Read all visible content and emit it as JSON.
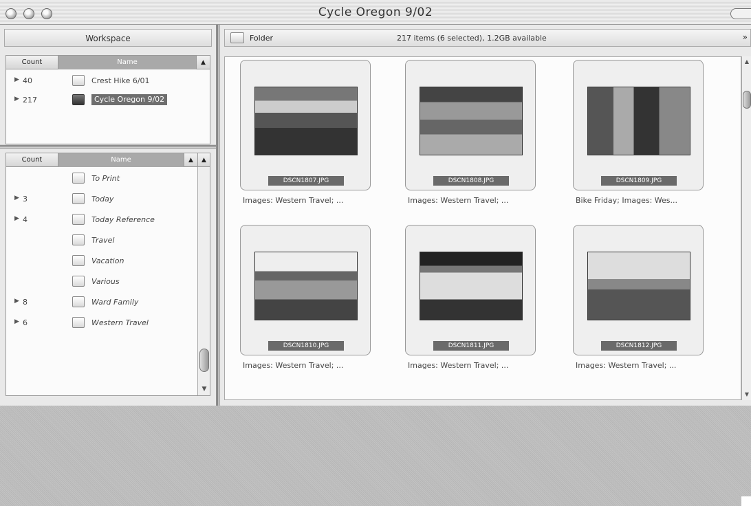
{
  "window": {
    "title": "Cycle Oregon 9/02"
  },
  "workspace": {
    "header": "Workspace",
    "top_panel": {
      "columns": {
        "count": "Count",
        "name": "Name"
      },
      "rows": [
        {
          "count": "40",
          "name": "Crest Hike 6/01",
          "selected": false
        },
        {
          "count": "217",
          "name": "Cycle Oregon 9/02",
          "selected": true
        }
      ]
    },
    "bottom_panel": {
      "columns": {
        "count": "Count",
        "name": "Name"
      },
      "rows": [
        {
          "count": "",
          "name": "To Print",
          "italic": true,
          "expandable": false
        },
        {
          "count": "3",
          "name": "Today",
          "italic": true,
          "expandable": true
        },
        {
          "count": "4",
          "name": "Today Reference",
          "italic": true,
          "expandable": true
        },
        {
          "count": "",
          "name": "Travel",
          "italic": true,
          "expandable": false
        },
        {
          "count": "",
          "name": "Vacation",
          "italic": true,
          "expandable": false
        },
        {
          "count": "",
          "name": "Various",
          "italic": true,
          "expandable": false
        },
        {
          "count": "8",
          "name": "Ward Family",
          "italic": true,
          "expandable": true
        },
        {
          "count": "6",
          "name": "Western Travel",
          "italic": true,
          "expandable": true
        }
      ]
    }
  },
  "browser": {
    "folder_label": "Folder",
    "status": "217 items (6 selected), 1.2GB available",
    "items": [
      {
        "filename": "DSCN1807.JPG",
        "caption": "Images: Western Travel; ..."
      },
      {
        "filename": "DSCN1808.JPG",
        "caption": "Images: Western Travel; ..."
      },
      {
        "filename": "DSCN1809.JPG",
        "caption": "Bike Friday; Images: Wes..."
      },
      {
        "filename": "DSCN1810.JPG",
        "caption": "Images: Western Travel; ..."
      },
      {
        "filename": "DSCN1811.JPG",
        "caption": "Images: Western Travel; ..."
      },
      {
        "filename": "DSCN1812.JPG",
        "caption": "Images: Western Travel; ..."
      }
    ]
  },
  "icons": {
    "sort": "▲",
    "expand": "▶",
    "scroll_up": "▲",
    "scroll_down": "▼",
    "more": "»"
  }
}
